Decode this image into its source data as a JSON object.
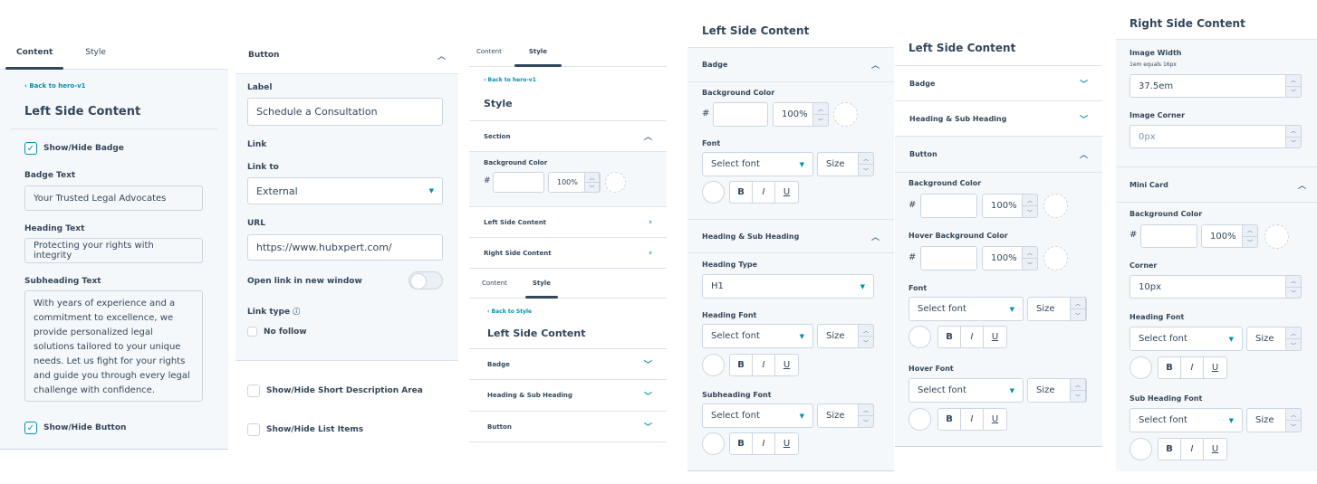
{
  "p1": {
    "tabs": [
      "Content",
      "Style"
    ],
    "back": "‹ Back to hero-v1",
    "title": "Left Side Content",
    "show_badge": "Show/Hide Badge",
    "badge_text_label": "Badge Text",
    "badge_text_value": "Your Trusted Legal Advocates",
    "heading_text_label": "Heading Text",
    "heading_text_value": "Protecting your rights with integrity",
    "subheading_label": "Subheading Text",
    "subheading_value": "With years of experience and a commitment to excellence, we provide personalized legal solutions tailored to your unique needs. Let us fight for your rights and guide you through every legal challenge with confidence.",
    "show_button": "Show/Hide Button"
  },
  "p2": {
    "section": "Button",
    "label_label": "Label",
    "label_value": "Schedule a Consultation",
    "link_label": "Link",
    "link_to_label": "Link to",
    "link_to_value": "External",
    "url_label": "URL",
    "url_value": "https://www.hubxpert.com/",
    "open_new": "Open link in new window",
    "link_type": "Link type",
    "nofollow": "No follow",
    "show_desc": "Show/Hide Short Description Area",
    "show_list": "Show/Hide List Items"
  },
  "p3": {
    "tabs": [
      "Content",
      "Style"
    ],
    "back": "‹ Back to hero-v1",
    "title": "Style",
    "section": "Section",
    "bg_color": "Background Color",
    "hash": "#",
    "pct": "100%",
    "left": "Left Side Content",
    "right": "Right Side Content",
    "tabs2": [
      "Content",
      "Style"
    ],
    "back2": "‹ Back to Style",
    "title2": "Left Side Content",
    "badge": "Badge",
    "heading": "Heading & Sub Heading",
    "button": "Button"
  },
  "p4": {
    "title": "Left Side Content",
    "badge": "Badge",
    "bg_color": "Background Color",
    "hash": "#",
    "pct": "100%",
    "font": "Font",
    "select_font": "Select font",
    "size": "Size",
    "b": "B",
    "i": "I",
    "u": "U",
    "heading_section": "Heading & Sub Heading",
    "heading_type": "Heading Type",
    "heading_type_value": "H1",
    "heading_font": "Heading Font",
    "subheading_font": "Subheading Font"
  },
  "p5": {
    "title": "Left Side Content",
    "badge": "Badge",
    "heading": "Heading & Sub Heading",
    "button": "Button",
    "bg_color": "Background Color",
    "hover_bg": "Hover Background Color",
    "hash": "#",
    "pct": "100%",
    "font": "Font",
    "hover_font": "Hover Font",
    "select_font": "Select font",
    "size": "Size",
    "b": "B",
    "i": "I",
    "u": "U"
  },
  "p6": {
    "title": "Right Side Content",
    "image_width": "Image Width",
    "em_hint": "1em equals 16px",
    "image_width_value": "37.5em",
    "image_corner": "Image Corner",
    "image_corner_value": "0px",
    "mini_card": "Mini Card",
    "bg_color": "Background Color",
    "hash": "#",
    "pct": "100%",
    "corner": "Corner",
    "corner_value": "10px",
    "heading_font": "Heading Font",
    "sub_heading_font": "Sub Heading Font",
    "select_font": "Select font",
    "size": "Size",
    "b": "B",
    "i": "I",
    "u": "U"
  }
}
